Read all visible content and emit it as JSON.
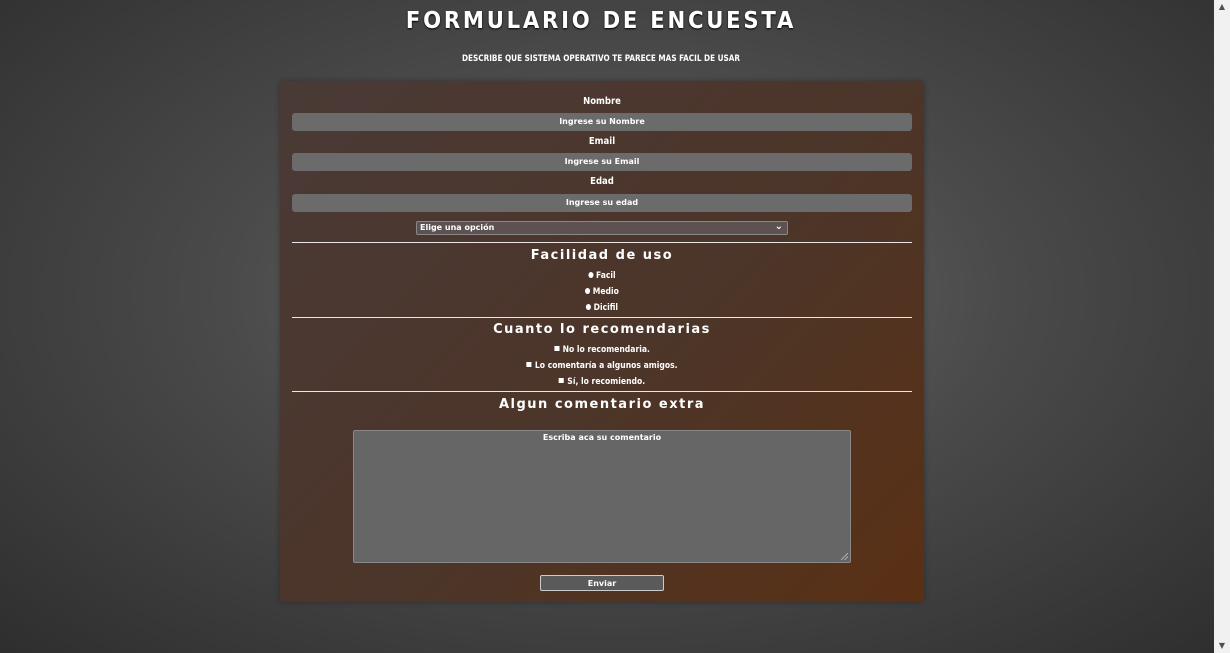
{
  "header": {
    "title": "FORMULARIO DE ENCUESTA",
    "subtitle": "DESCRIBE QUE SISTEMA OPERATIVO TE PARECE MAS FACIL DE USAR"
  },
  "form": {
    "name_label": "Nombre",
    "name_placeholder": "Ingrese su Nombre",
    "email_label": "Email",
    "email_placeholder": "Ingrese su Email",
    "age_label": "Edad",
    "age_placeholder": "Ingrese su edad",
    "select_value": "Elige una opción",
    "ease": {
      "title": "Facilidad de uso",
      "options": [
        "Facil",
        "Medio",
        "Dicifil"
      ]
    },
    "recommend": {
      "title": "Cuanto lo recomendarias",
      "options": [
        "No lo recomendaria.",
        "Lo comentaría a algunos amigos.",
        "Sí, lo recomiendo."
      ]
    },
    "comment": {
      "title": "Algun comentario extra",
      "placeholder": "Escriba aca su comentario"
    },
    "submit_label": "Enviar"
  },
  "icons": {
    "select_chevron": "chevron-down-icon",
    "scroll_up": "scroll-up-arrow-icon",
    "scroll_down": "scroll-down-arrow-icon"
  }
}
